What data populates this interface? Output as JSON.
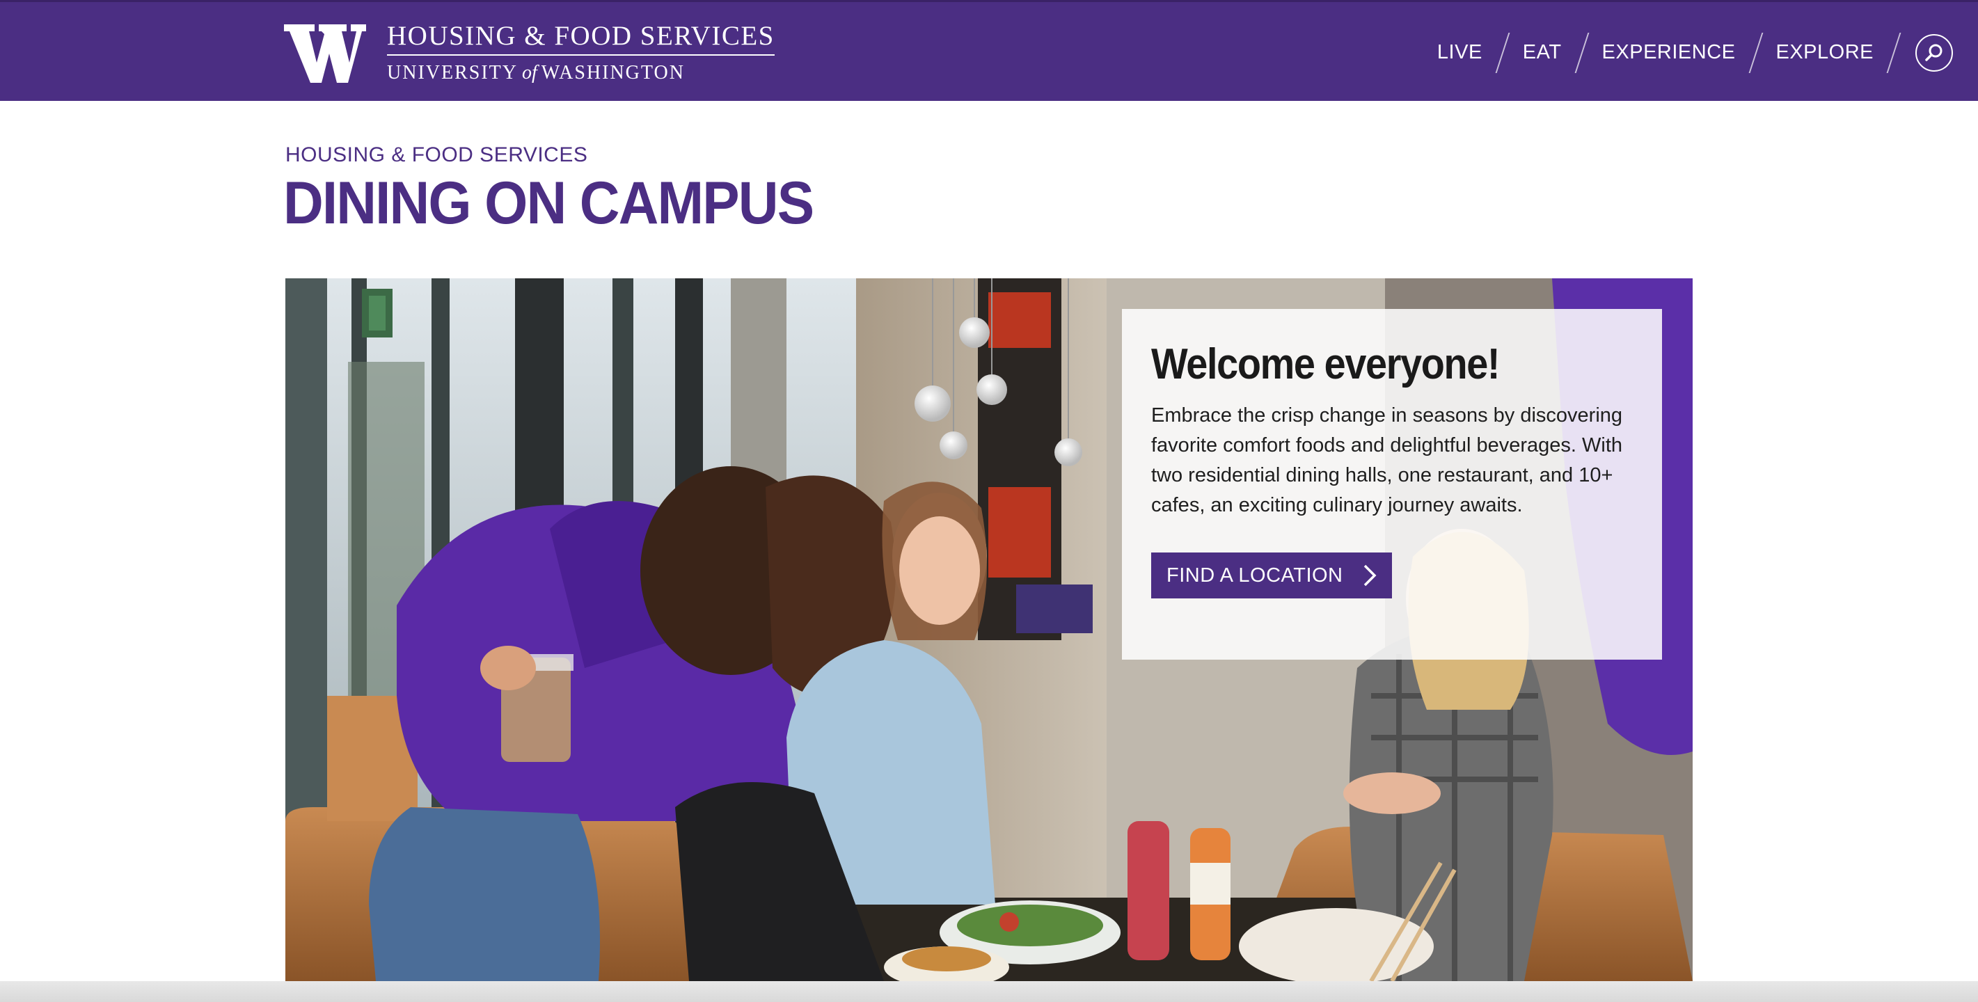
{
  "header": {
    "brand_line1": "HOUSING & FOOD SERVICES",
    "brand_line2_a": "UNIVERSITY",
    "brand_line2_of": "of",
    "brand_line2_b": "WASHINGTON",
    "logo_icon": "uw-w-logo-icon",
    "nav": [
      {
        "label": "LIVE"
      },
      {
        "label": "EAT"
      },
      {
        "label": "EXPERIENCE"
      },
      {
        "label": "EXPLORE"
      }
    ],
    "search_icon": "search-icon"
  },
  "page": {
    "eyebrow": "HOUSING & FOOD SERVICES",
    "title": "DINING ON CAMPUS"
  },
  "hero": {
    "image_icon": "students-dining-photo",
    "card": {
      "title": "Welcome everyone!",
      "body": "Embrace the crisp change in seasons by discovering favorite comfort foods and delightful beverages. With two residential dining halls, one restaurant, and 10+ cafes, an exciting culinary journey awaits.",
      "cta_label": "FIND A LOCATION",
      "cta_icon": "chevron-right-icon"
    }
  },
  "colors": {
    "brand_purple": "#4b2e83",
    "background": "#ffffff"
  }
}
